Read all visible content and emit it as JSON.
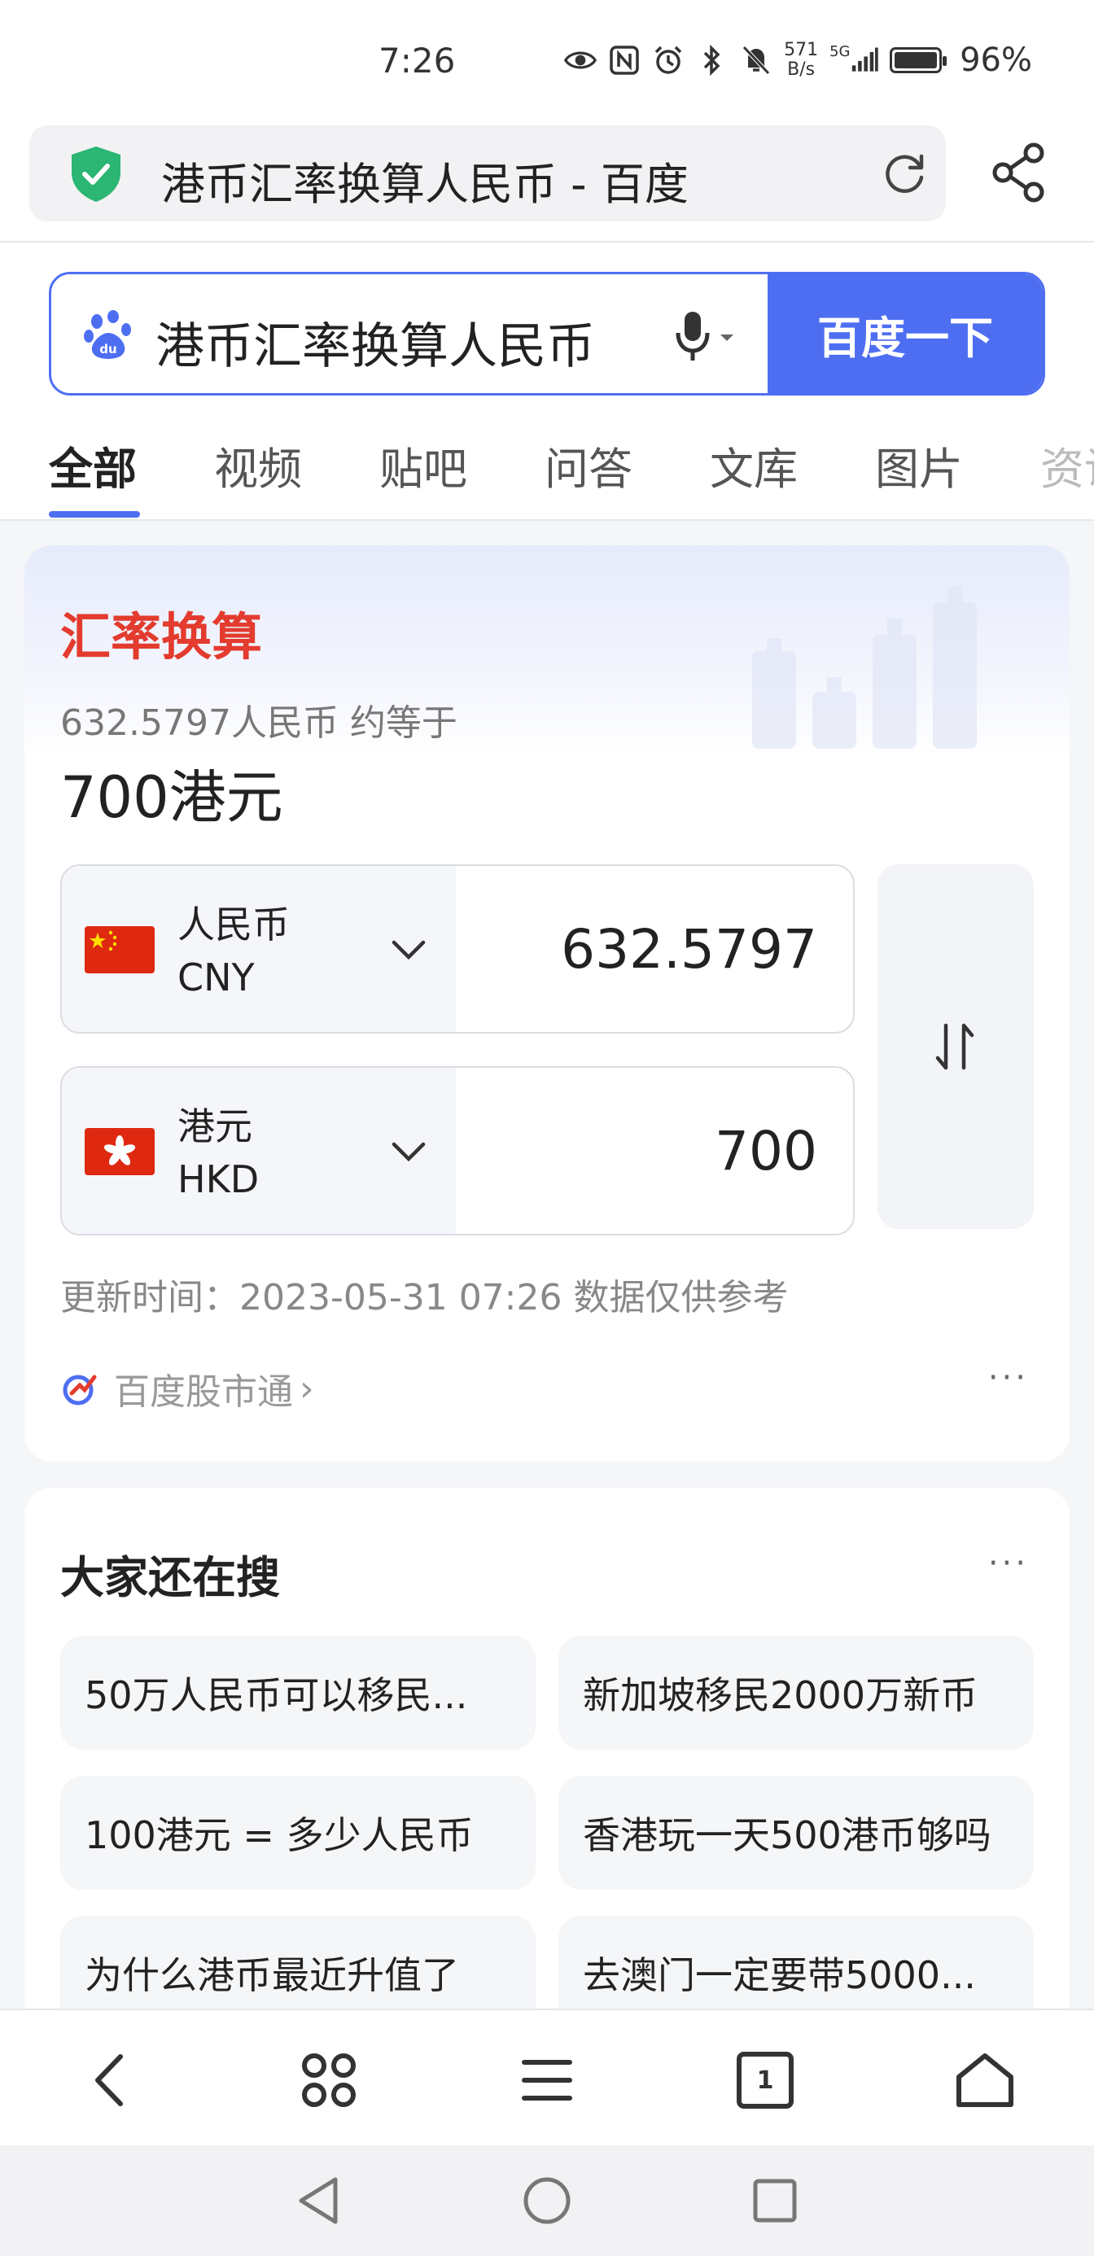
{
  "status_bar": {
    "time": "7:26",
    "net_speed_value": "571",
    "net_speed_unit": "B/s",
    "signal_label": "5G",
    "battery": "96%"
  },
  "url_bar": {
    "title": "港币汇率换算人民币 - 百度",
    "security_icon": "shield-check-icon",
    "reload_icon": "reload-icon",
    "share_icon": "share-icon"
  },
  "search": {
    "query": "港币汇率换算人民币",
    "button_label": "百度一下"
  },
  "tabs": [
    {
      "label": "全部",
      "active": true
    },
    {
      "label": "视频"
    },
    {
      "label": "贴吧"
    },
    {
      "label": "问答"
    },
    {
      "label": "文库"
    },
    {
      "label": "图片"
    },
    {
      "label": "资讯"
    }
  ],
  "exchange": {
    "title": "汇率换算",
    "summary": "632.5797人民币 约等于",
    "result": "700港元",
    "from": {
      "name": "人民币",
      "code": "CNY",
      "value": "632.5797"
    },
    "to": {
      "name": "港元",
      "code": "HKD",
      "value": "700"
    },
    "update_text": "更新时间：2023-05-31 07:26 数据仅供参考",
    "source_label": "百度股市通",
    "source_arrow": "›",
    "more_label": "···"
  },
  "related": {
    "title": "大家还在搜",
    "more_label": "···",
    "items": [
      "50万人民币可以移民...",
      "新加坡移民2000万新币",
      "100港元 = 多少人民币",
      "香港玩一天500港币够吗",
      "为什么港币最近升值了",
      "去澳门一定要带5000..."
    ]
  },
  "browser_bar": {
    "tab_count": "1"
  },
  "colors": {
    "accent": "#4e6ef2",
    "title_red": "#e33b2e"
  }
}
